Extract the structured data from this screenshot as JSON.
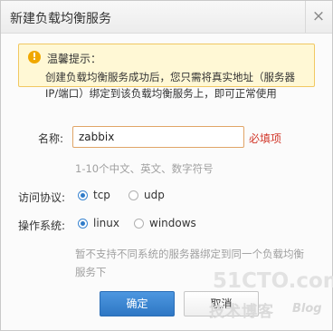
{
  "dialog": {
    "title": "新建负载均衡服务",
    "close_glyph": "×"
  },
  "tip": {
    "icon": "!",
    "title": "温馨提示：",
    "lines": [
      "创建负载均衡服务成功后，您只需将真实地址（服务器",
      "IP/端口）绑定到该负载均衡服务上，即可正常使用"
    ]
  },
  "form": {
    "name_label": "名称:",
    "name_value": "zabbix",
    "name_required": "必填项",
    "name_hint": "1-10个中文、英文、数字符号",
    "protocol_label": "访问协议:",
    "protocol_options": [
      {
        "label": "tcp",
        "checked": true
      },
      {
        "label": "udp",
        "checked": false
      }
    ],
    "os_label": "操作系统:",
    "os_options": [
      {
        "label": "linux",
        "checked": true
      },
      {
        "label": "windows",
        "checked": false
      }
    ],
    "os_hint_lines": [
      "暂不支持不同系统的服务器绑定到同一个负载均衡",
      "服务下"
    ]
  },
  "buttons": {
    "confirm": "确定",
    "cancel": "取消"
  },
  "watermark": {
    "main": "51CTO.com",
    "sub": "技术博客",
    "blog": "Blog"
  },
  "colors": {
    "accent": "#2f7bc8",
    "required": "#d2382b",
    "tip_bg": "#fff8d5"
  }
}
